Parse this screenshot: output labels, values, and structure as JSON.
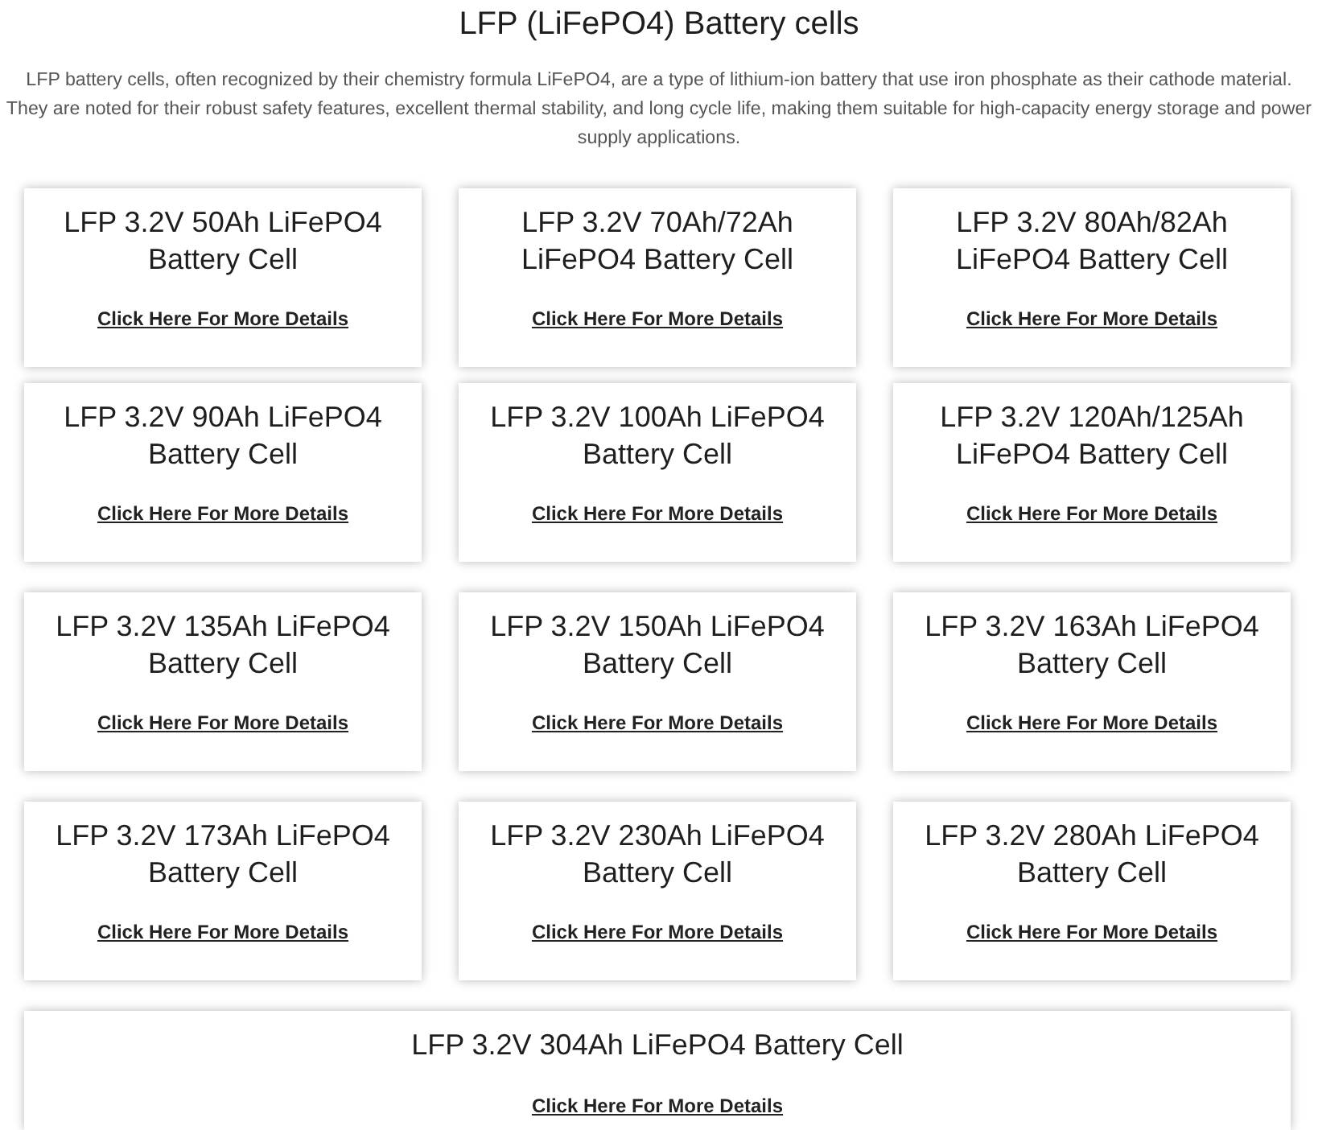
{
  "page": {
    "title": "LFP (LiFePO4) Battery cells",
    "description": "LFP battery cells, often recognized by their chemistry formula LiFePO4, are a type of lithium-ion battery that use iron phosphate as their cathode material. They are noted for their robust safety features, excellent thermal stability, and long cycle life, making them suitable for high-capacity energy storage and power supply applications."
  },
  "card_rows": [
    [
      {
        "title": "LFP 3.2V 50Ah LiFePO4 Battery Cell",
        "link": "Click Here For More Details"
      },
      {
        "title": "LFP 3.2V 70Ah/72Ah LiFePO4 Battery Cell",
        "link": "Click Here For More Details"
      },
      {
        "title": "LFP 3.2V 80Ah/82Ah LiFePO4 Battery Cell",
        "link": "Click Here For More Details"
      }
    ],
    [
      {
        "title": "LFP 3.2V 90Ah LiFePO4 Battery Cell",
        "link": "Click Here For More Details"
      },
      {
        "title": "LFP 3.2V 100Ah LiFePO4 Battery Cell",
        "link": "Click Here For More Details"
      },
      {
        "title": "LFP 3.2V 120Ah/125Ah LiFePO4 Battery Cell",
        "link": "Click Here For More Details"
      }
    ],
    [
      {
        "title": "LFP 3.2V 135Ah LiFePO4 Battery Cell",
        "link": "Click Here For More Details"
      },
      {
        "title": "LFP 3.2V 150Ah LiFePO4 Battery Cell",
        "link": "Click Here For More Details"
      },
      {
        "title": "LFP 3.2V 163Ah LiFePO4 Battery Cell",
        "link": "Click Here For More Details"
      }
    ],
    [
      {
        "title": "LFP 3.2V 173Ah LiFePO4 Battery Cell",
        "link": "Click Here For More Details"
      },
      {
        "title": "LFP 3.2V 230Ah LiFePO4 Battery Cell",
        "link": "Click Here For More Details"
      },
      {
        "title": "LFP 3.2V 280Ah LiFePO4 Battery Cell",
        "link": "Click Here For More Details"
      }
    ],
    [
      {
        "title": "LFP 3.2V 304Ah LiFePO4 Battery Cell",
        "link": "Click Here For More Details"
      }
    ]
  ]
}
